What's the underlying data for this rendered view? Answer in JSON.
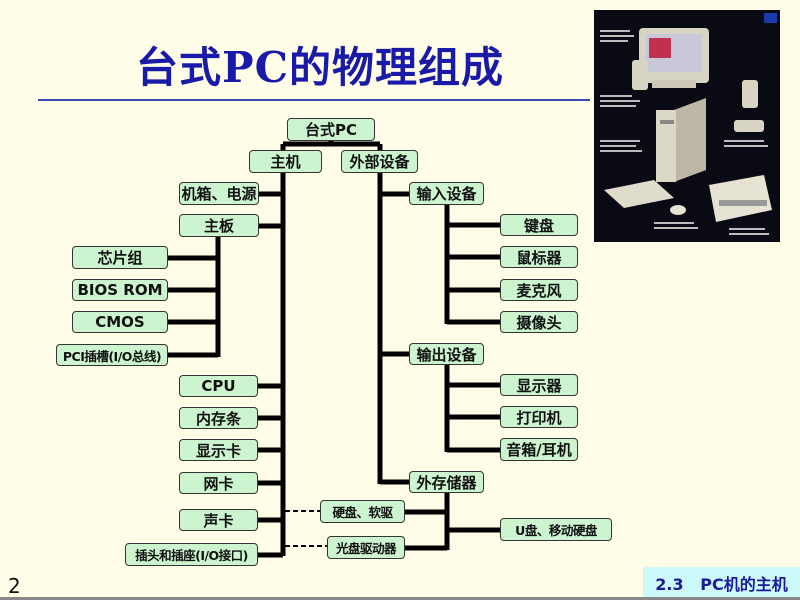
{
  "slide": {
    "title": "台式PC的物理组成",
    "page_number": "2",
    "footer": "2.3   PC机的主机",
    "colors": {
      "background": "#fffde8",
      "title": "#1a1aa8",
      "box_fill": "#ccf5cf",
      "footer_fill": "#ccfafa"
    }
  },
  "diagram": {
    "root": "台式PC",
    "host": "主机",
    "peripherals": "外部设备",
    "host_items": {
      "case_power": "机箱、电源",
      "motherboard": "主板",
      "motherboard_items": [
        "芯片组",
        "BIOS ROM",
        "CMOS",
        "PCI插槽(I/O总线)"
      ],
      "cpu": "CPU",
      "memory": "内存条",
      "graphics": "显示卡",
      "network": "网卡",
      "sound": "声卡",
      "io_ports": "插头和插座(I/O接口)"
    },
    "input": {
      "label": "输入设备",
      "items": [
        "键盘",
        "鼠标器",
        "麦克风",
        "摄像头"
      ]
    },
    "output": {
      "label": "输出设备",
      "items": [
        "显示器",
        "打印机",
        "音箱/耳机"
      ]
    },
    "storage": {
      "label": "外存储器",
      "hdd": "硬盘、软驱",
      "optical": "光盘驱动器",
      "usb": "U盘、移动硬盘"
    }
  },
  "photo": {
    "subject": "desktop-pc-components-photo"
  }
}
